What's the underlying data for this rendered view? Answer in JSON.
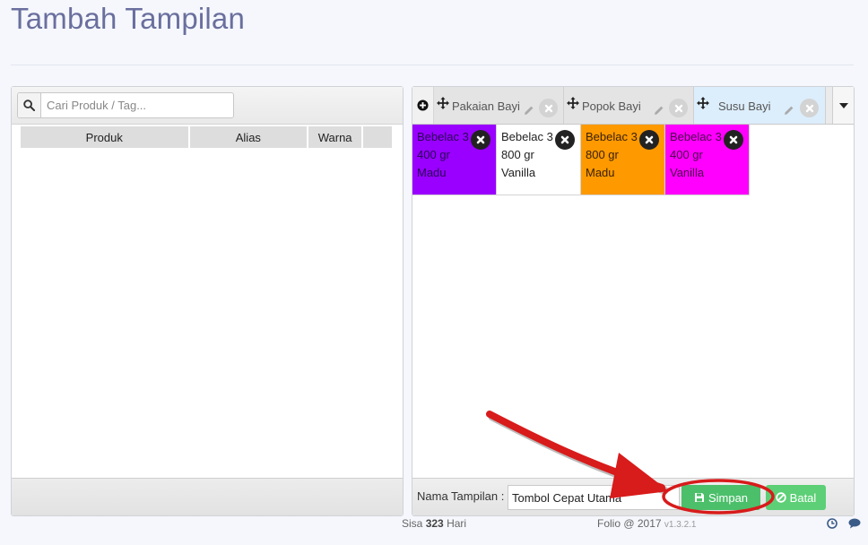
{
  "page": {
    "title": "Tambah Tampilan"
  },
  "search": {
    "placeholder": "Cari Produk / Tag..."
  },
  "product_table": {
    "columns": [
      "Produk",
      "Alias",
      "Warna",
      ""
    ]
  },
  "tabs": [
    {
      "label": "Pakaian Bayi"
    },
    {
      "label": "Popok Bayi"
    },
    {
      "label": "Susu Bayi",
      "active": true
    }
  ],
  "tiles": [
    {
      "line1": "Bebelac 3",
      "line2": "400 gr",
      "line3": "Madu",
      "bg": "#9900ff",
      "fg": "#2a0055"
    },
    {
      "line1": "Bebelac 3",
      "line2": "800 gr",
      "line3": "Vanilla",
      "bg": "#ffffff",
      "fg": "#222222"
    },
    {
      "line1": "Bebelac 3",
      "line2": "800 gr",
      "line3": "Madu",
      "bg": "#ff9900",
      "fg": "#3a2200"
    },
    {
      "line1": "Bebelac 3",
      "line2": "400 gr",
      "line3": "Vanilla",
      "bg": "#ff00ff",
      "fg": "#4a004a"
    }
  ],
  "form": {
    "name_label": "Nama Tampilan :",
    "name_value": "Tombol Cepat Utama",
    "save_label": "Simpan",
    "cancel_label": "Batal"
  },
  "footer": {
    "sisa_prefix": "Sisa",
    "sisa_days": "323",
    "sisa_suffix": "Hari",
    "folio": "Folio @ 2017",
    "version": "v1.3.2.1"
  },
  "colors": {
    "title": "#6a6f9e",
    "save": "#4cbf6a",
    "cancel": "#5dcf76",
    "annotation": "#d81b1b",
    "active_tab": "#dceefc"
  }
}
